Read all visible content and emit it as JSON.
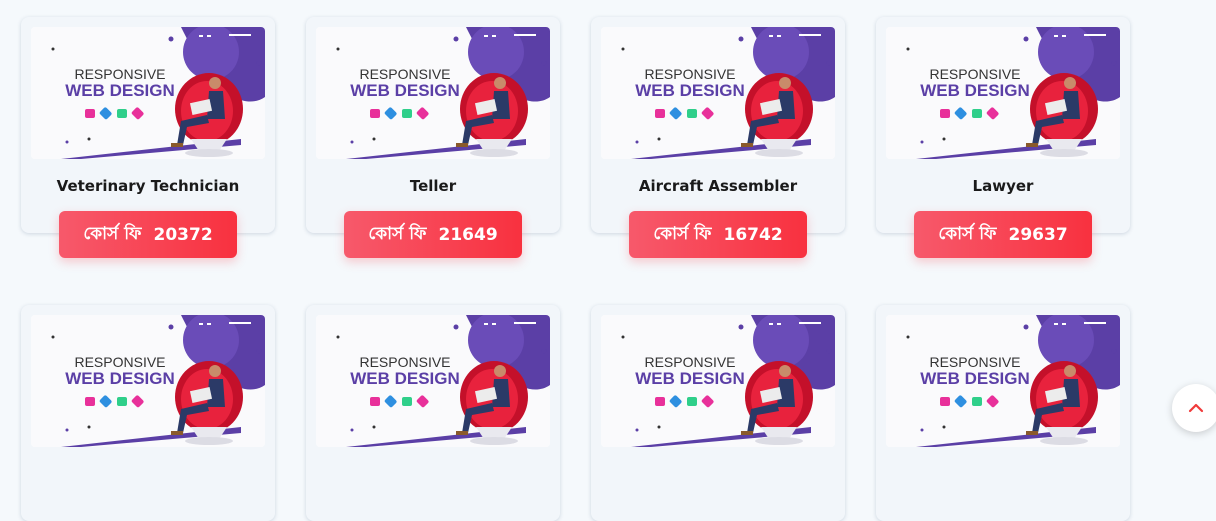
{
  "courses": [
    {
      "title": "Veterinary Technician",
      "fee_label": "কোর্স ফি",
      "fee": "20372"
    },
    {
      "title": "Teller",
      "fee_label": "কোর্স ফি",
      "fee": "21649"
    },
    {
      "title": "Aircraft Assembler",
      "fee_label": "কোর্স ফি",
      "fee": "16742"
    },
    {
      "title": "Lawyer",
      "fee_label": "কোর্স ফি",
      "fee": "29637"
    },
    {
      "title": "",
      "fee_label": "",
      "fee": ""
    },
    {
      "title": "",
      "fee_label": "",
      "fee": ""
    },
    {
      "title": "",
      "fee_label": "",
      "fee": ""
    },
    {
      "title": "",
      "fee_label": "",
      "fee": ""
    }
  ],
  "thumbnail": {
    "line1": "RESPONSIVE",
    "line2": "WEB DESIGN"
  },
  "icons": {
    "scroll_top": "chevron-up-icon",
    "thumbnail": "responsive-web-design-illustration"
  },
  "colors": {
    "accent": "#f8313f",
    "purple": "#5b3fa6"
  }
}
